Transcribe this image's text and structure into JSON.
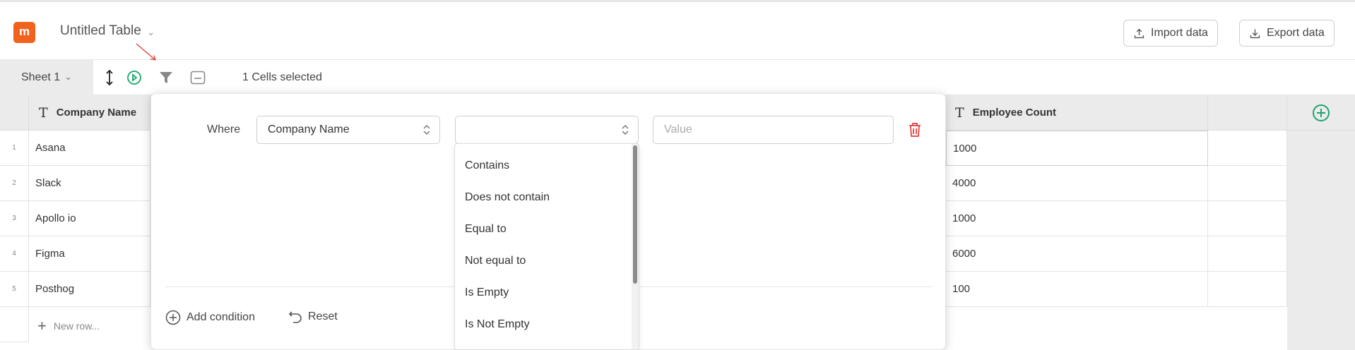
{
  "app": {
    "logo_letter": "m",
    "title": "Untitled Table",
    "import_label": "Import data",
    "export_label": "Export data",
    "accent_color": "#f2621f"
  },
  "toolbar": {
    "sheet_tab": "Sheet 1",
    "status": "1 Cells selected"
  },
  "table": {
    "columns": [
      {
        "label": "Company Name",
        "type_icon": "T"
      },
      {
        "label": "Employee Count",
        "type_icon": "T"
      }
    ],
    "rows": [
      {
        "num": "1",
        "company": "Asana",
        "employees": "1000"
      },
      {
        "num": "2",
        "company": "Slack",
        "employees": "4000"
      },
      {
        "num": "3",
        "company": "Apollo io",
        "employees": "1000"
      },
      {
        "num": "4",
        "company": "Figma",
        "employees": "6000"
      },
      {
        "num": "5",
        "company": "Posthog",
        "employees": "100"
      }
    ],
    "new_row_label": "New row..."
  },
  "filter": {
    "where_label": "Where",
    "field_value": "Company Name",
    "operator_value": "",
    "value_placeholder": "Value",
    "add_condition_label": "Add condition",
    "reset_label": "Reset",
    "operator_options": [
      "Contains",
      "Does not contain",
      "Equal to",
      "Not equal to",
      "Is Empty",
      "Is Not Empty"
    ]
  }
}
